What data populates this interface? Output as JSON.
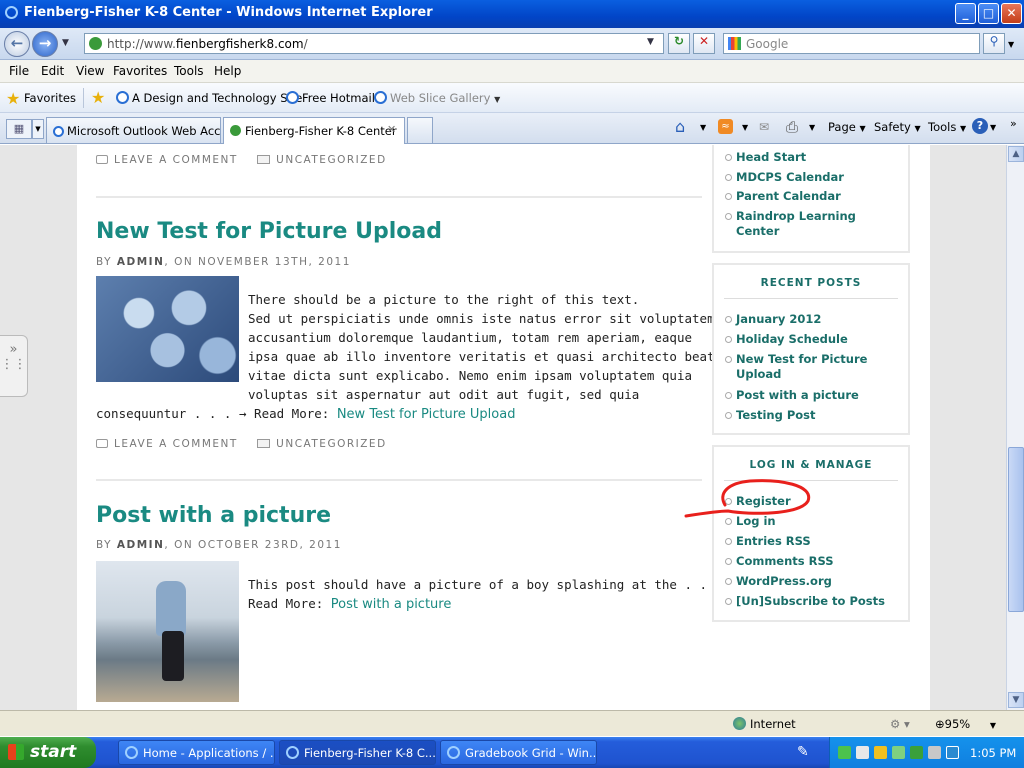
{
  "window": {
    "title": "Fienberg-Fisher K-8 Center - Windows Internet Explorer",
    "min": "_",
    "max": "□",
    "close": "✕"
  },
  "address": {
    "url_prefix": "http://www.",
    "url_domain": "fienbergfisherk8.com",
    "url_suffix": "/",
    "search_placeholder": "Google"
  },
  "menu": [
    "File",
    "Edit",
    "View",
    "Favorites",
    "Tools",
    "Help"
  ],
  "favorites": {
    "label": "Favorites",
    "items": [
      "A Design and Technology Site",
      "Free Hotmail",
      "Web Slice Gallery"
    ]
  },
  "tabs": [
    {
      "label": "Microsoft Outlook Web Access"
    },
    {
      "label": "Fienberg-Fisher K-8 Center"
    }
  ],
  "commands": {
    "page": "Page",
    "safety": "Safety",
    "tools": "Tools"
  },
  "posts": [
    {
      "meta_comment": "LEAVE A COMMENT",
      "meta_category": "UNCATEGORIZED"
    },
    {
      "title": "New Test for Picture Upload",
      "by_prefix": "BY ",
      "author": "ADMIN",
      "date": ", ON NOVEMBER 13TH, 2011",
      "lines": [
        "There should be a picture to the right of this text.",
        "Sed ut perspiciatis unde omnis iste natus error sit voluptatem",
        "accusantium doloremque laudantium, totam rem aperiam, eaque",
        "ipsa quae ab illo inventore veritatis et quasi architecto beatae",
        "vitae dicta sunt explicabo. Nemo enim ipsam voluptatem quia",
        "voluptas sit aspernatur aut odit aut fugit, sed quia"
      ],
      "last_line": "consequuntur . . . → Read More: ",
      "read_more": "New Test for Picture Upload",
      "meta_comment": "LEAVE A COMMENT",
      "meta_category": "UNCATEGORIZED"
    },
    {
      "title": "Post with a picture",
      "by_prefix": "BY ",
      "author": "ADMIN",
      "date": ", ON OCTOBER 23RD, 2011",
      "line1": "This post should have a picture of a boy splashing at the . . . →",
      "line2": "Read More: ",
      "read_more": "Post with a picture"
    }
  ],
  "sidebar": {
    "links_top": [
      "Head Start",
      "MDCPS Calendar",
      "Parent Calendar",
      "Raindrop Learning",
      "Center"
    ],
    "recent_title": "RECENT POSTS",
    "recent": [
      "January 2012",
      "Holiday Schedule",
      "New Test for Picture",
      "Upload",
      "Post with a picture",
      "Testing Post"
    ],
    "login_title": "LOG IN & MANAGE",
    "login": [
      "Register",
      "Log in",
      "Entries RSS",
      "Comments RSS",
      "WordPress.org",
      "[Un]Subscribe to Posts"
    ]
  },
  "status": {
    "zone": "Internet",
    "zoom": "95%"
  },
  "taskbar": {
    "start": "start",
    "tasks": [
      "Home - Applications / ...",
      "Fienberg-Fisher K-8 C...",
      "Gradebook Grid - Win..."
    ],
    "clock": "1:05 PM"
  },
  "annotation_color": "#e8201c",
  "accent_color": "#1a8a82"
}
